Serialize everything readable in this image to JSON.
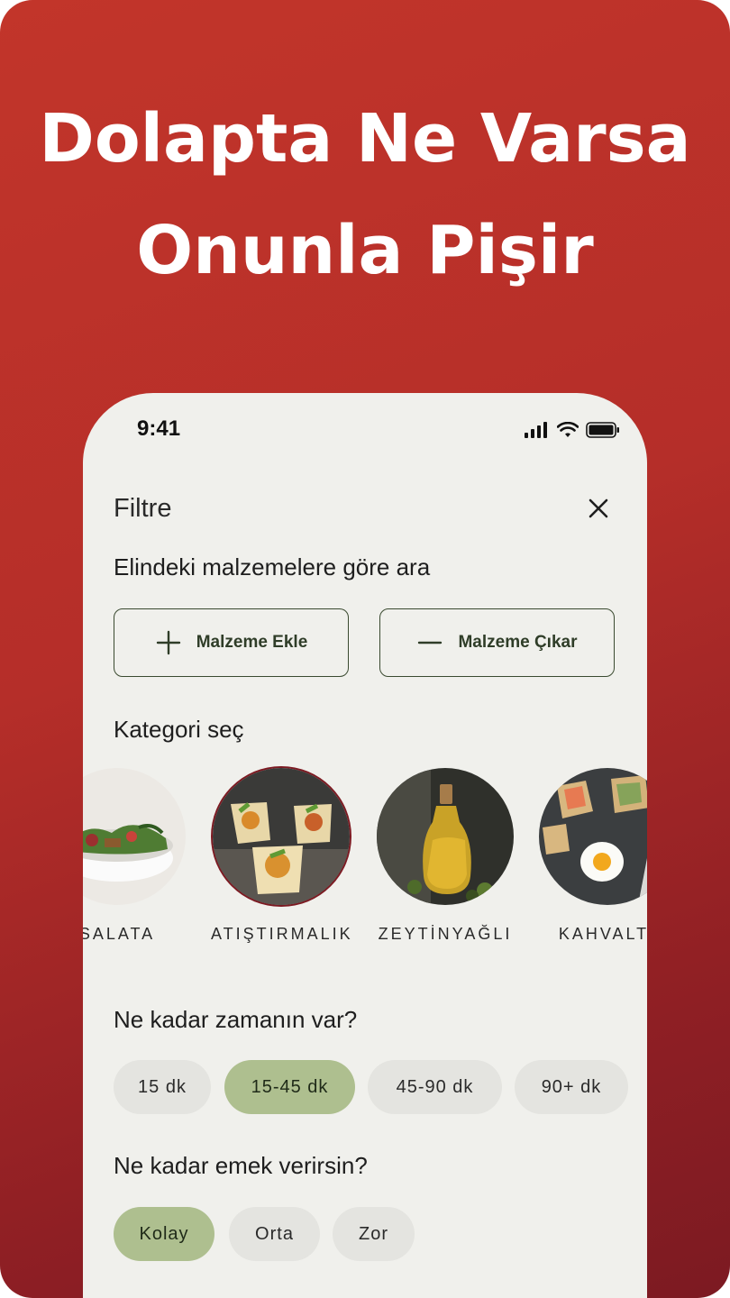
{
  "headline": {
    "line1": "Dolapta Ne Varsa",
    "line2": "Onunla Pişir"
  },
  "status_bar": {
    "time": "9:41",
    "icons": [
      "cellular-signal-icon",
      "wifi-icon",
      "battery-icon"
    ]
  },
  "filter": {
    "title": "Filtre",
    "close_icon": "close-icon",
    "ingredients": {
      "label": "Elindeki malzemelere göre ara",
      "add_label": "Malzeme Ekle",
      "remove_label": "Malzeme Çıkar"
    },
    "categories": {
      "label": "Kategori seç",
      "items": [
        {
          "label": "SALATA",
          "selected": false
        },
        {
          "label": "ATIŞTIRMALIK",
          "selected": true
        },
        {
          "label": "ZEYTİNYAĞLI",
          "selected": false
        },
        {
          "label": "KAHVALTI",
          "selected": false
        }
      ]
    },
    "time": {
      "label": "Ne kadar zamanın var?",
      "options": [
        "15 dk",
        "15-45 dk",
        "45-90 dk",
        "90+ dk"
      ],
      "selected": "15-45 dk"
    },
    "effort": {
      "label": "Ne kadar emek verirsin?",
      "options": [
        "Kolay",
        "Orta",
        "Zor"
      ],
      "selected": "Kolay"
    }
  },
  "colors": {
    "brand_red": "#b52e29",
    "dark_red": "#7c1a22",
    "selected_chip": "#aebf8f",
    "chip": "#e4e4e0",
    "sheet_bg": "#f0f0ec"
  }
}
